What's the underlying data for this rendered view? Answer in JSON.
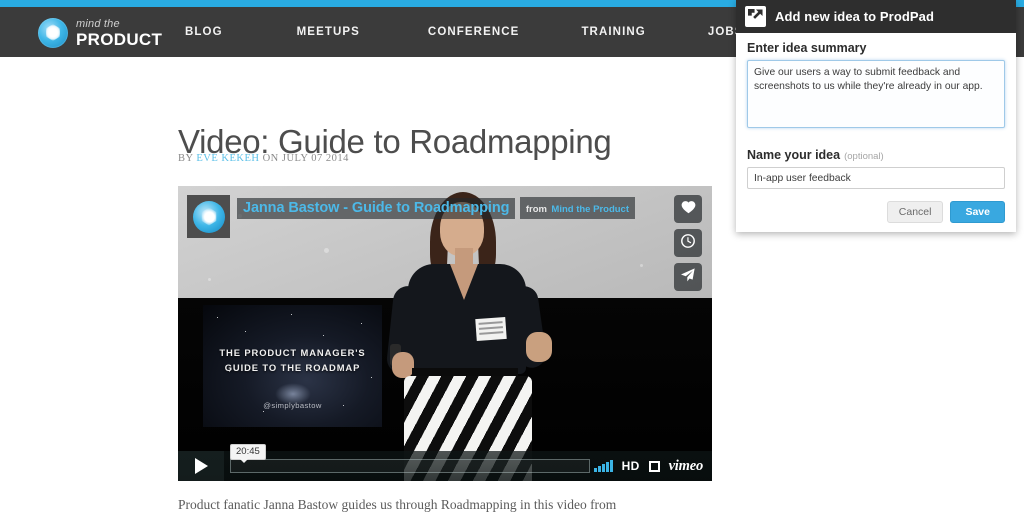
{
  "site": {
    "logo": {
      "line1": "mind the",
      "line2": "PRODUCT",
      "icon": "mind-the-product-logo-icon"
    },
    "nav": [
      {
        "label": "BLOG"
      },
      {
        "label": "MEETUPS"
      },
      {
        "label": "CONFERENCE"
      },
      {
        "label": "TRAINING"
      },
      {
        "label": "JOBS"
      }
    ],
    "accent_color": "#29abe2",
    "nav_bg": "#3b3b3b"
  },
  "article": {
    "title": "Video: Guide to Roadmapping",
    "byline_prefix": "BY",
    "author": "EVE KEKEH",
    "byline_mid": "ON",
    "date": "JULY 07 2014",
    "body_excerpt": "Product fanatic Janna Bastow guides us through Roadmapping in this video from"
  },
  "video": {
    "title": "Janna Bastow - Guide to Roadmapping",
    "from_label": "from",
    "channel": "Mind the Product",
    "time_tooltip": "20:45",
    "quality_label": "HD",
    "provider": "vimeo",
    "actions": [
      {
        "name": "like-icon",
        "glyph": "heart"
      },
      {
        "name": "watch-later-icon",
        "glyph": "clock"
      },
      {
        "name": "share-icon",
        "glyph": "paper-plane"
      }
    ],
    "slide": {
      "line1": "THE PRODUCT MANAGER'S",
      "line2": "GUIDE TO THE ROADMAP",
      "handle": "@simplybastow"
    }
  },
  "prodpad": {
    "header_title": "Add new idea to ProdPad",
    "header_icon": "prodpad-arrow-icon",
    "summary_label": "Enter idea summary",
    "summary_value": "Give our users a way to submit feedback and screenshots to us while they're already in our app.",
    "summary_placeholder": "Enter idea summary",
    "name_label": "Name your idea",
    "name_optional": "(optional)",
    "name_value": "In-app user feedback",
    "name_placeholder": "Name your idea",
    "cancel_label": "Cancel",
    "save_label": "Save",
    "save_color": "#39a8e0",
    "header_bg": "#2e2e2e"
  }
}
